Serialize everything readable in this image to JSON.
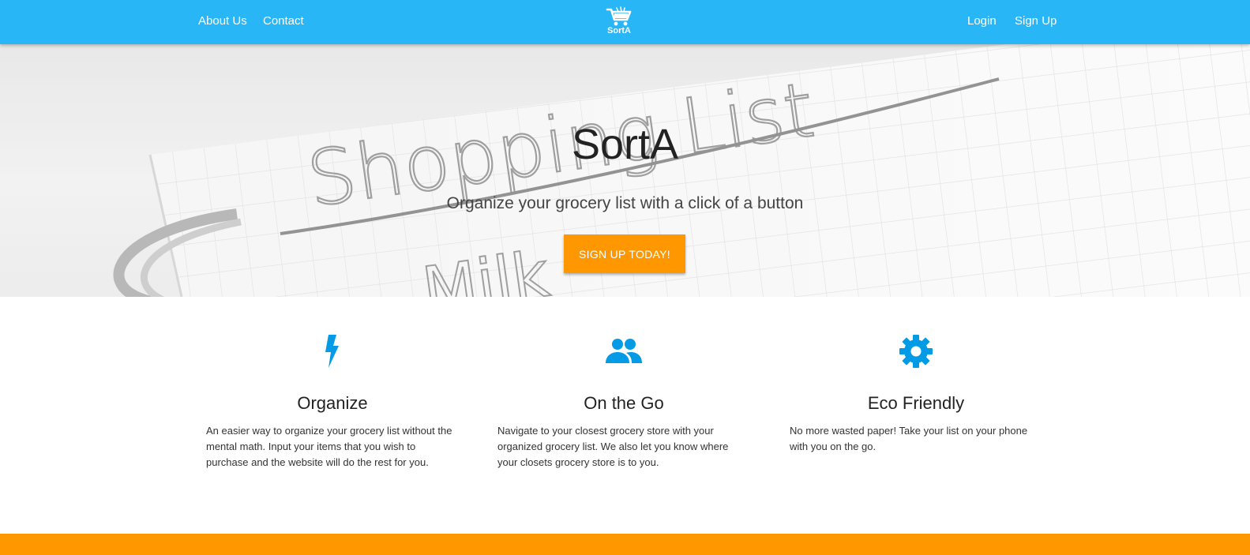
{
  "nav": {
    "links_left": [
      "About Us",
      "Contact"
    ],
    "brand": "SortA",
    "links_right": [
      "Login",
      "Sign Up"
    ]
  },
  "hero": {
    "title": "SortA",
    "subtitle": "Organize your grocery list with a click of a button",
    "cta": "SIGN UP TODAY!",
    "background_image_text": [
      "Shopping List",
      "Milk"
    ]
  },
  "features": [
    {
      "icon": "flash-icon",
      "title": "Organize",
      "text": "An easier way to organize your grocery list without the mental math. Input your items that you wish to purchase and the website will do the rest for you."
    },
    {
      "icon": "people-icon",
      "title": "On the Go",
      "text": "Navigate to your closest grocery store with your organized grocery list. We also let you know where your closets grocery store is to you."
    },
    {
      "icon": "gear-icon",
      "title": "Eco Friendly",
      "text": "No more wasted paper! Take your list on your phone with you on the go."
    }
  ],
  "colors": {
    "navbar": "#29b6f6",
    "accent": "#ff9800",
    "icon": "#039be5"
  }
}
